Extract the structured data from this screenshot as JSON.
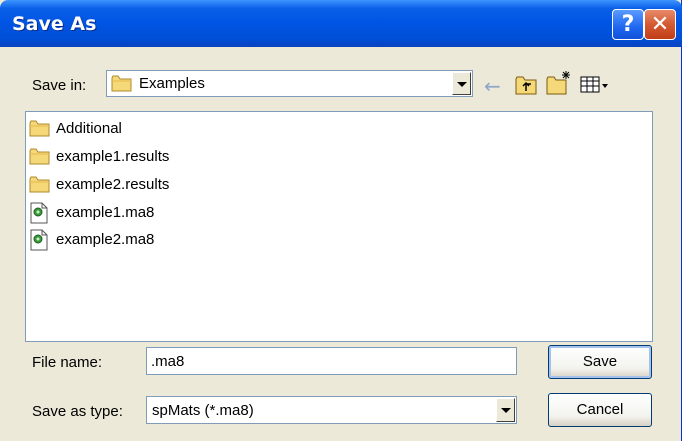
{
  "window": {
    "title": "Save As"
  },
  "title_buttons": {
    "help": "?",
    "close": "✕"
  },
  "save_in": {
    "label": "Save in:",
    "value": "Examples"
  },
  "toolbar": {
    "back_glyph": "←"
  },
  "files": [
    {
      "name": "Additional",
      "type": "folder"
    },
    {
      "name": "example1.results",
      "type": "folder"
    },
    {
      "name": "example2.results",
      "type": "folder"
    },
    {
      "name": "example1.ma8",
      "type": "file"
    },
    {
      "name": "example2.ma8",
      "type": "file"
    }
  ],
  "file_name": {
    "label": "File name:",
    "value": ".ma8"
  },
  "save_type": {
    "label": "Save as type:",
    "value": "spMats (*.ma8)"
  },
  "buttons": {
    "save": "Save",
    "cancel": "Cancel"
  },
  "colors": {
    "titlebar": "#0054e3",
    "folder": "#f5d878",
    "face": "#ece9d8"
  }
}
